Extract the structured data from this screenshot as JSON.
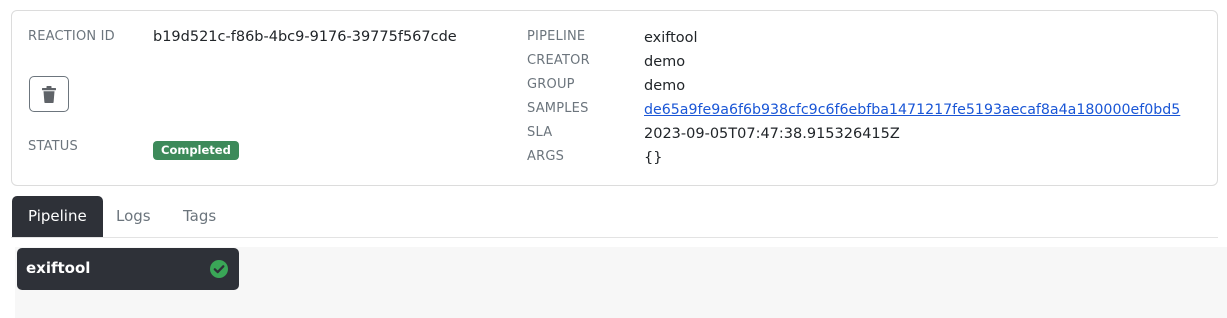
{
  "reaction": {
    "id_label": "REACTION ID",
    "id_value": "b19d521c-f86b-4bc9-9176-39775f567cde",
    "status_label": "STATUS",
    "status_value": "Completed"
  },
  "details": {
    "pipeline_label": "PIPELINE",
    "pipeline_value": "exiftool",
    "creator_label": "CREATOR",
    "creator_value": "demo",
    "group_label": "GROUP",
    "group_value": "demo",
    "samples_label": "SAMPLES",
    "samples_value": "de65a9fe9a6f6b938cfc9c6f6ebfba1471217fe5193aecaf8a4a180000ef0bd5",
    "sla_label": "SLA",
    "sla_value": "2023-09-05T07:47:38.915326415Z",
    "args_label": "ARGS",
    "args_value": "{}"
  },
  "tabs": [
    {
      "label": "Pipeline",
      "active": true
    },
    {
      "label": "Logs",
      "active": false
    },
    {
      "label": "Tags",
      "active": false
    }
  ],
  "pipeline_graph": {
    "nodes": [
      {
        "label": "exiftool",
        "status": "success"
      }
    ]
  },
  "icons": {
    "delete": "trash-icon",
    "node_status": "check-circle-icon"
  },
  "colors": {
    "status_badge": "#3d8a5a",
    "active_tab": "#2e3138",
    "link": "#1a56d6",
    "check": "#3aa657"
  }
}
